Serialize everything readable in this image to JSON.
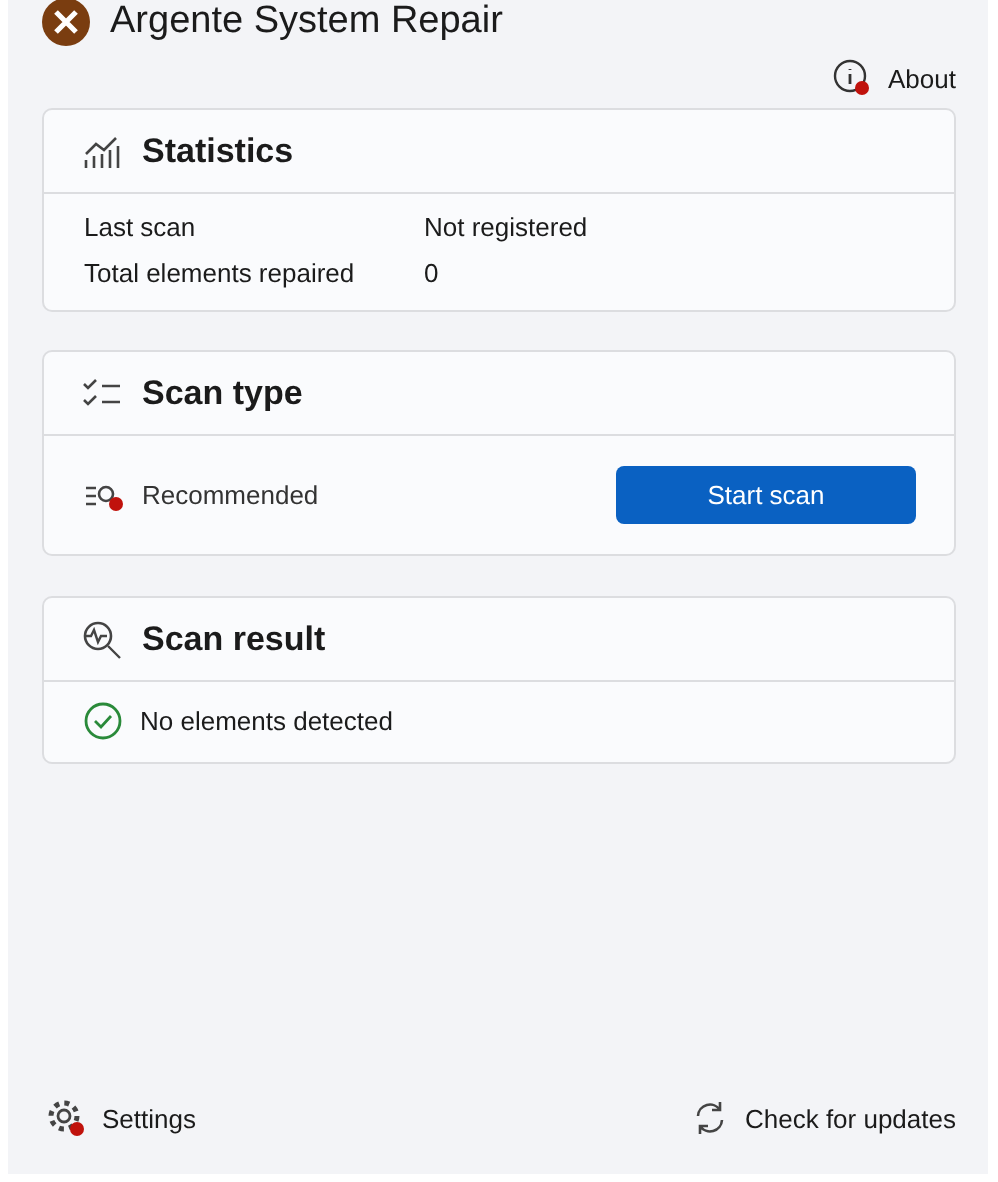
{
  "window": {
    "title": "Argente System Repair"
  },
  "about_link": "About",
  "statistics": {
    "title": "Statistics",
    "rows": [
      {
        "label": "Last scan",
        "value": "Not registered"
      },
      {
        "label": "Total elements repaired",
        "value": "0"
      }
    ]
  },
  "scan_type": {
    "title": "Scan type",
    "option": "Recommended",
    "button": "Start scan"
  },
  "scan_result": {
    "title": "Scan result",
    "message": "No elements detected"
  },
  "footer": {
    "settings": "Settings",
    "updates": "Check for updates"
  }
}
